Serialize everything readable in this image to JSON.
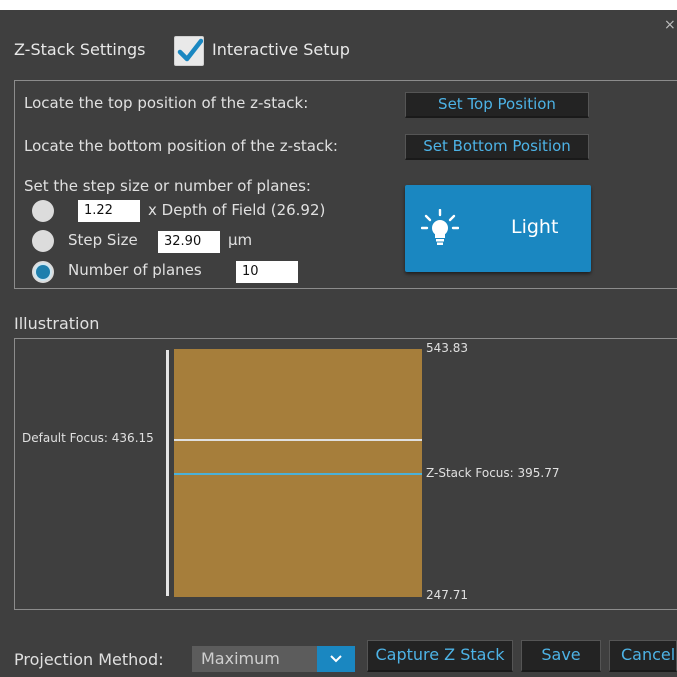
{
  "window": {
    "close_glyph": "×",
    "title": "Z-Stack Settings",
    "interactive_setup": {
      "label": "Interactive Setup",
      "checked": true
    }
  },
  "settings": {
    "top_label": "Locate the top position of the z-stack:",
    "top_button": "Set Top Position",
    "bottom_label": "Locate the bottom position of the z-stack:",
    "bottom_button": "Set Bottom Position",
    "step_heading": "Set the step size or number of planes:",
    "options": {
      "dof": {
        "value": "1.22",
        "suffix": "x Depth of Field (26.92)",
        "selected": false
      },
      "step_size": {
        "label": "Step Size",
        "value": "32.90",
        "unit": "µm",
        "selected": false
      },
      "planes": {
        "label": "Number of planes",
        "value": "10",
        "selected": true
      }
    },
    "light_button": {
      "label": "Light",
      "icon": "light-bulb-icon"
    }
  },
  "illustration": {
    "title": "Illustration",
    "top_value": "543.83",
    "bottom_value": "247.71",
    "default_focus": "Default Focus: 436.15",
    "zstack_focus": "Z-Stack Focus: 395.77",
    "colors": {
      "stack": "#a67e3b",
      "default_line": "#e0e0e0",
      "zstack_line": "#4bb1d9"
    }
  },
  "footer": {
    "projection_label": "Projection Method:",
    "projection_value": "Maximum",
    "capture_button": "Capture Z Stack",
    "save_button": "Save",
    "cancel_button": "Cancel"
  },
  "colors": {
    "accent": "#1a87c1",
    "link_text": "#4db3e6",
    "background": "#3f3f3f"
  }
}
